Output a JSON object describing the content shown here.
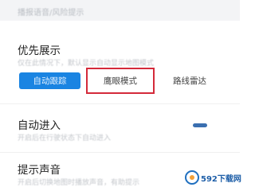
{
  "header": {
    "text": "播报语音/风险提示"
  },
  "priority": {
    "title": "优先展示",
    "description": "仅在此情况下，默认显示自动显示地图模式",
    "options": [
      {
        "label": "自动跟踪",
        "selected": true
      },
      {
        "label": "鹰眼模式",
        "selected": false
      },
      {
        "label": "路线雷达",
        "selected": false
      }
    ],
    "accent_color": "#1a84e2",
    "highlight_color": "#d42a3a"
  },
  "auto_enter": {
    "title": "自动进入",
    "description": "开启后在行驶状态下自动进入"
  },
  "prompt_sound": {
    "title": "提示声音",
    "description": "开启后切换地图时播放声音，有助提示"
  },
  "watermark": {
    "text": "592下载网"
  }
}
